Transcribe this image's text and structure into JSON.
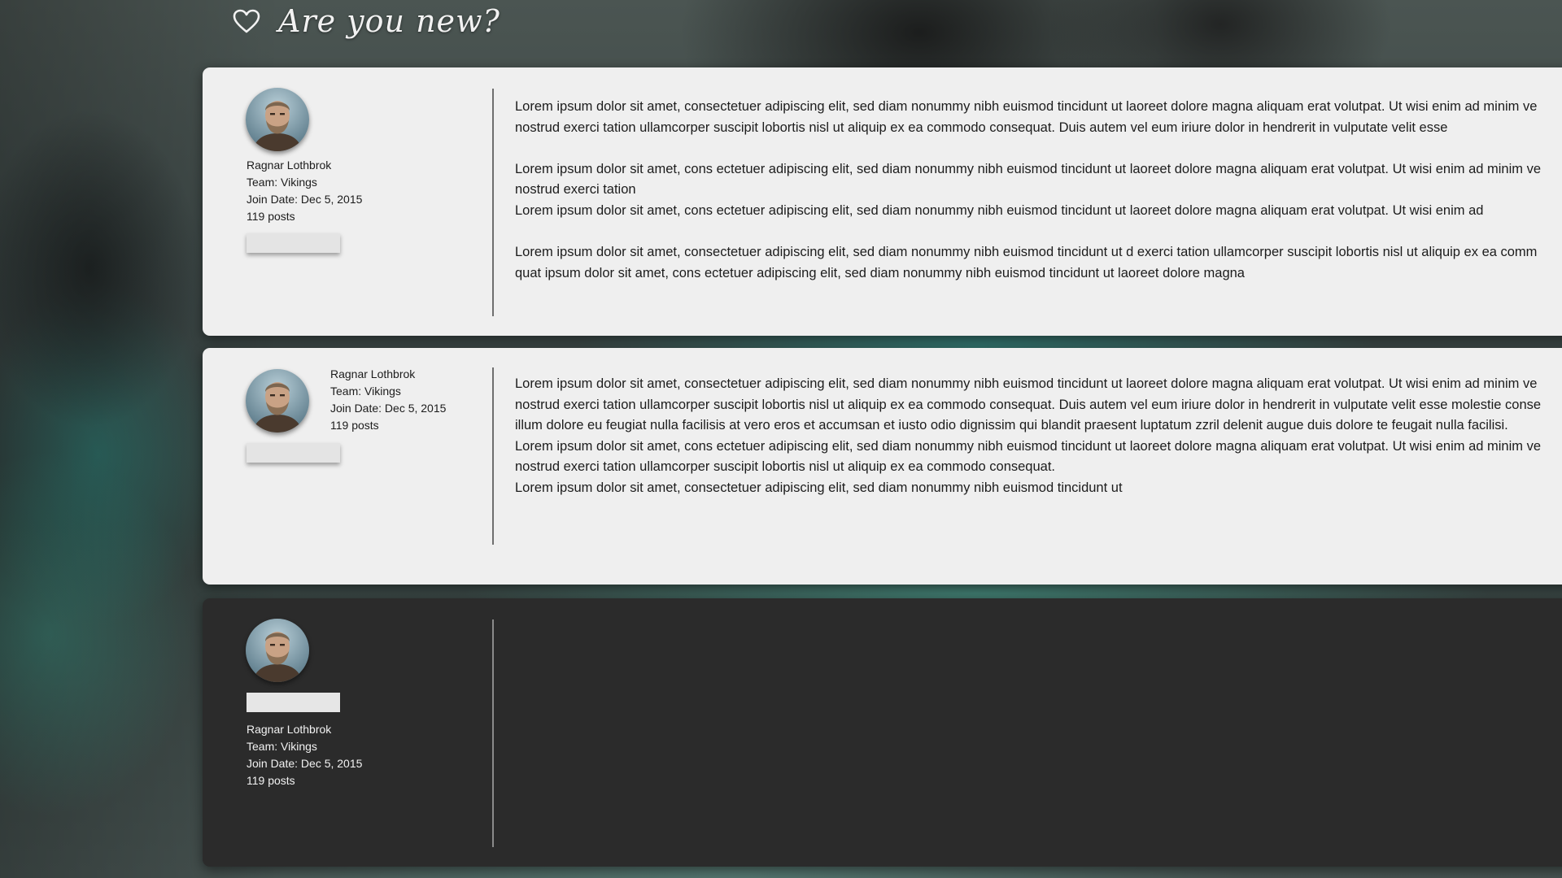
{
  "header": {
    "title": "Are you new?",
    "icon": "heart-icon"
  },
  "posts": [
    {
      "theme": "light",
      "user": {
        "name": "Ragnar Lothbrok",
        "team": "Team: Vikings",
        "join_date": "Join Date: Dec 5, 2015",
        "posts": "119 posts"
      },
      "lines": [
        "Lorem ipsum dolor sit amet, consectetuer adipiscing elit, sed diam nonummy nibh euismod tincidunt ut laoreet dolore magna aliquam erat volutpat. Ut wisi enim ad minim ve",
        "nostrud exerci tation ullamcorper suscipit lobortis nisl ut aliquip ex ea commodo consequat. Duis autem vel eum iriure dolor in hendrerit in vulputate velit esse",
        "",
        "Lorem ipsum dolor sit amet, cons ectetuer adipiscing elit, sed diam nonummy nibh euismod tincidunt ut laoreet dolore magna aliquam erat volutpat. Ut wisi enim ad minim ve",
        "nostrud exerci tation",
        "Lorem ipsum dolor sit amet, cons ectetuer adipiscing elit, sed diam nonummy nibh euismod tincidunt ut laoreet dolore magna aliquam erat volutpat. Ut wisi enim ad",
        "",
        "Lorem ipsum dolor sit amet, consectetuer adipiscing elit, sed diam nonummy nibh euismod tincidunt ut d exerci tation ullamcorper suscipit lobortis nisl ut aliquip ex ea comm",
        "quat ipsum dolor sit amet, cons ectetuer adipiscing elit, sed diam nonummy nibh euismod tincidunt ut laoreet dolore magna"
      ]
    },
    {
      "theme": "light",
      "user": {
        "name": "Ragnar Lothbrok",
        "team": "Team: Vikings",
        "join_date": "Join Date: Dec 5, 2015",
        "posts": "119 posts"
      },
      "lines": [
        "Lorem ipsum dolor sit amet, consectetuer adipiscing elit, sed diam nonummy nibh euismod tincidunt ut laoreet dolore magna aliquam erat volutpat. Ut wisi enim ad minim ve",
        "nostrud exerci tation ullamcorper suscipit lobortis nisl ut aliquip ex ea commodo consequat. Duis autem vel eum iriure dolor in hendrerit in vulputate velit esse molestie conse",
        "illum dolore eu feugiat nulla facilisis at vero eros et accumsan et iusto odio dignissim qui blandit praesent luptatum zzril delenit augue duis dolore te feugait nulla facilisi.",
        "Lorem ipsum dolor sit amet, cons ectetuer adipiscing elit, sed diam nonummy nibh euismod tincidunt ut laoreet dolore magna aliquam erat volutpat. Ut wisi enim ad minim ve",
        "nostrud exerci tation ullamcorper suscipit lobortis nisl ut aliquip ex ea commodo consequat.",
        "Lorem ipsum dolor sit amet, consectetuer adipiscing elit, sed diam nonummy nibh euismod tincidunt ut"
      ]
    },
    {
      "theme": "dark",
      "user": {
        "name": "Ragnar Lothbrok",
        "team": "Team: Vikings",
        "join_date": "Join Date: Dec 5, 2015",
        "posts": "119 posts"
      },
      "lines": []
    }
  ]
}
